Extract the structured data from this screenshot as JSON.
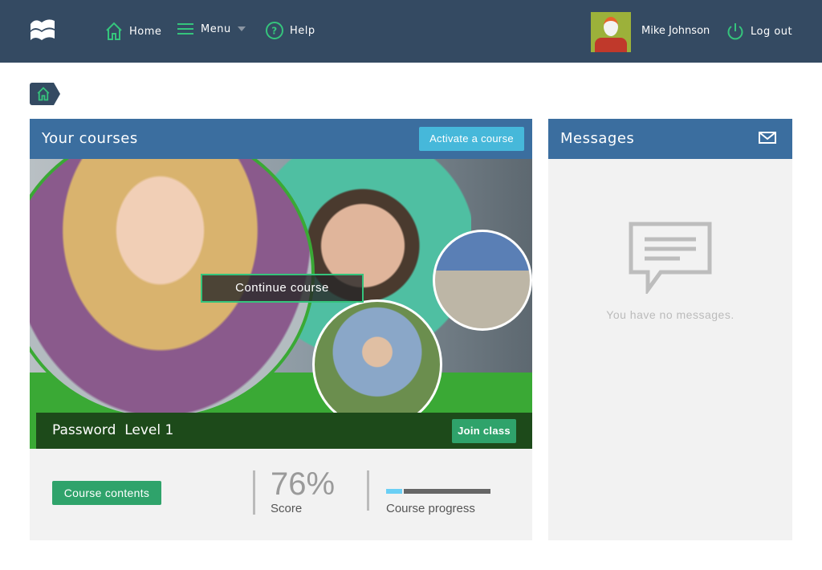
{
  "header": {
    "nav": [
      {
        "label": "Home",
        "icon": "home-icon"
      },
      {
        "label": "Menu",
        "icon": "menu-icon"
      },
      {
        "label": "Help",
        "icon": "help-icon"
      }
    ],
    "user_name": "Mike Johnson",
    "logout_label": "Log out"
  },
  "courses": {
    "title": "Your courses",
    "activate_label": "Activate a course",
    "continue_label": "Continue course",
    "course_name": "Password  Level 1",
    "join_label": "Join class",
    "contents_label": "Course contents",
    "score": "76%",
    "score_label": "Score",
    "progress_label": "Course progress",
    "progress_percent": 17
  },
  "messages": {
    "title": "Messages",
    "empty_text": "You have no messages."
  },
  "colors": {
    "header": "#344a62",
    "accent_green": "#35c47c",
    "panel_header": "#3b6e9f",
    "button_green": "#2fa36b",
    "activate": "#46b8da",
    "progress": "#6acff5"
  }
}
